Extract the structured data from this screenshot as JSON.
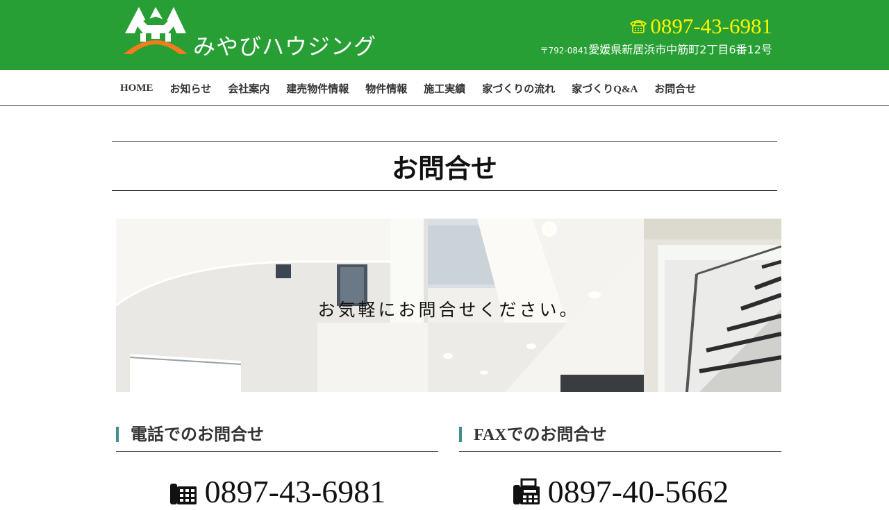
{
  "header": {
    "company_name": "みやびハウジング",
    "phone": "0897-43-6981",
    "postal": "〒792-0841",
    "address": "愛媛県新居浜市中筋町2丁目6番12号",
    "colors": {
      "header_bg": "#279f34",
      "phone": "#fff500",
      "logo_orange": "#f07c1c"
    }
  },
  "nav": {
    "items": [
      {
        "label": "HOME"
      },
      {
        "label": "お知らせ"
      },
      {
        "label": "会社案内"
      },
      {
        "label": "建売物件情報"
      },
      {
        "label": "物件情報"
      },
      {
        "label": "施工実績"
      },
      {
        "label": "家づくりの流れ"
      },
      {
        "label": "家づくりQ&A"
      },
      {
        "label": "お問合せ"
      }
    ]
  },
  "page": {
    "title": "お問合せ",
    "hero_text": "お気軽にお問合せください。"
  },
  "sections": {
    "phone": {
      "title": "電話でのお問合せ",
      "number": "0897-43-6981",
      "icon": "phone-icon"
    },
    "fax": {
      "title": "FAXでのお問合せ",
      "number": "0897-40-5662",
      "icon": "fax-icon"
    }
  }
}
